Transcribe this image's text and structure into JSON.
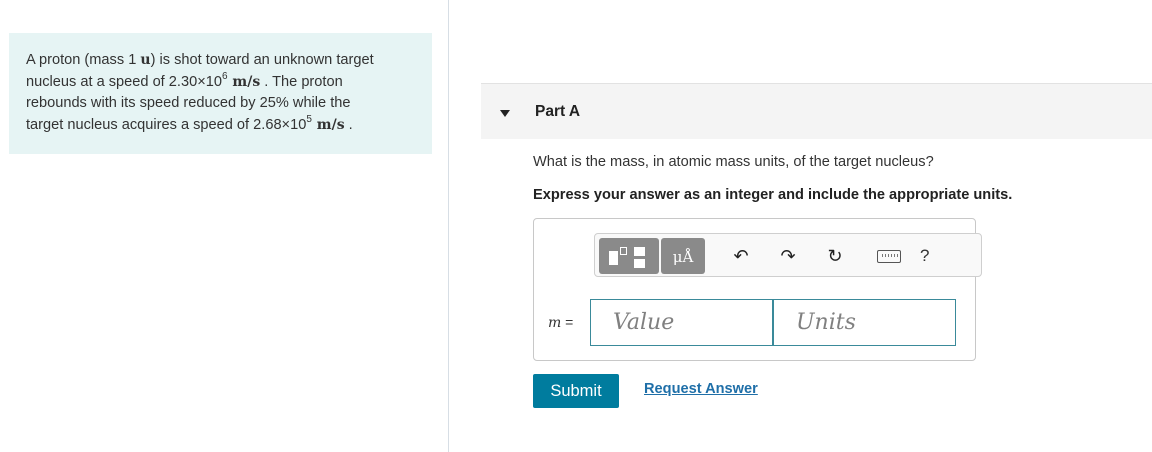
{
  "problem": {
    "line1_a": "A proton (mass 1 ",
    "line1_unit": "u",
    "line1_b": ") is shot toward an unknown target",
    "line2_a": "nucleus at a speed of 2.30×10",
    "line2_exp": "6",
    "line2_unit": " m/s",
    "line2_b": " . The proton",
    "line3": "rebounds with its speed reduced by 25% while the",
    "line4_a": "target nucleus acquires a speed of 2.68×10",
    "line4_exp": "5",
    "line4_unit": " m/s",
    "line4_b": " ."
  },
  "part": {
    "title": "Part A",
    "question": "What is the mass, in atomic mass units, of the target nucleus?",
    "instruction": "Express your answer as an integer and include the appropriate units."
  },
  "toolbar": {
    "units_label": "μÅ",
    "undo_glyph": "↶",
    "redo_glyph": "↷",
    "reset_glyph": "↻",
    "help_label": "?",
    "icons": [
      "templates-icon",
      "units-icon",
      "undo-icon",
      "redo-icon",
      "reset-icon",
      "keyboard-icon",
      "help-icon"
    ]
  },
  "answer": {
    "variable": "m",
    "equals": " =",
    "value_placeholder": "Value",
    "units_placeholder": "Units"
  },
  "actions": {
    "submit_label": "Submit",
    "request_label": "Request Answer"
  },
  "colors": {
    "problem_bg": "#e6f4f4",
    "submit_bg": "#007c9e",
    "link": "#1f6fa8",
    "field_border": "#3a8a9a"
  }
}
